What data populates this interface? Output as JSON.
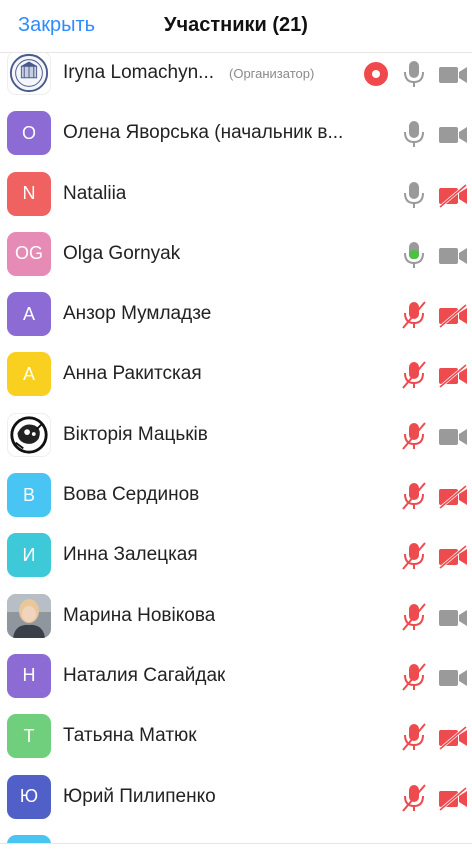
{
  "header": {
    "close_label": "Закрыть",
    "title": "Участники (21)"
  },
  "colors": {
    "accent": "#2d8cff",
    "muted_red": "#ee4b4f",
    "active_green": "#4fbf4a",
    "icon_gray": "#9a9a9a"
  },
  "participants": [
    {
      "name": "Iryna Lomachyn...",
      "role": "(Организатор)",
      "initial": "",
      "avatar_color": "#ffffff",
      "avatar_type": "emblem",
      "recording": true,
      "mic": "on",
      "video": "on"
    },
    {
      "name": "Олена Яворська (начальник в...",
      "role": "",
      "initial": "О",
      "avatar_color": "#8c6bd4",
      "avatar_type": "initial",
      "recording": false,
      "mic": "on",
      "video": "on"
    },
    {
      "name": "Nataliia",
      "role": "",
      "initial": "N",
      "avatar_color": "#f06161",
      "avatar_type": "initial",
      "recording": false,
      "mic": "on",
      "video": "off"
    },
    {
      "name": "Olga Gornyak",
      "role": "",
      "initial": "OG",
      "avatar_color": "#e58bb6",
      "avatar_type": "initial",
      "recording": false,
      "mic": "active",
      "video": "on"
    },
    {
      "name": "Анзор Мумладзе",
      "role": "",
      "initial": "А",
      "avatar_color": "#8c6bd4",
      "avatar_type": "initial",
      "recording": false,
      "mic": "off",
      "video": "off"
    },
    {
      "name": "Анна Ракитская",
      "role": "",
      "initial": "А",
      "avatar_color": "#f9d020",
      "avatar_type": "initial",
      "recording": false,
      "mic": "off",
      "video": "off"
    },
    {
      "name": "Вікторія Мацьків",
      "role": "",
      "initial": "",
      "avatar_color": "#ffffff",
      "avatar_type": "sketch",
      "recording": false,
      "mic": "off",
      "video": "on"
    },
    {
      "name": "Вова Сердинов",
      "role": "",
      "initial": "В",
      "avatar_color": "#48c5f2",
      "avatar_type": "initial",
      "recording": false,
      "mic": "off",
      "video": "off"
    },
    {
      "name": "Инна Залецкая",
      "role": "",
      "initial": "И",
      "avatar_color": "#3ec9d8",
      "avatar_type": "initial",
      "recording": false,
      "mic": "off",
      "video": "off"
    },
    {
      "name": "Марина Новікова",
      "role": "",
      "initial": "",
      "avatar_color": "#9aa0a8",
      "avatar_type": "photo",
      "recording": false,
      "mic": "off",
      "video": "on"
    },
    {
      "name": "Наталия Сагайдак",
      "role": "",
      "initial": "Н",
      "avatar_color": "#8c6bd4",
      "avatar_type": "initial",
      "recording": false,
      "mic": "off",
      "video": "on"
    },
    {
      "name": "Татьяна Матюк",
      "role": "",
      "initial": "Т",
      "avatar_color": "#6fcf7c",
      "avatar_type": "initial",
      "recording": false,
      "mic": "off",
      "video": "off"
    },
    {
      "name": "Юрий Пилипенко",
      "role": "",
      "initial": "Ю",
      "avatar_color": "#5060c8",
      "avatar_type": "initial",
      "recording": false,
      "mic": "off",
      "video": "off"
    },
    {
      "name": "",
      "role": "",
      "initial": "",
      "avatar_color": "#48c5f2",
      "avatar_type": "initial",
      "recording": false,
      "mic": "off",
      "video": "off"
    }
  ]
}
